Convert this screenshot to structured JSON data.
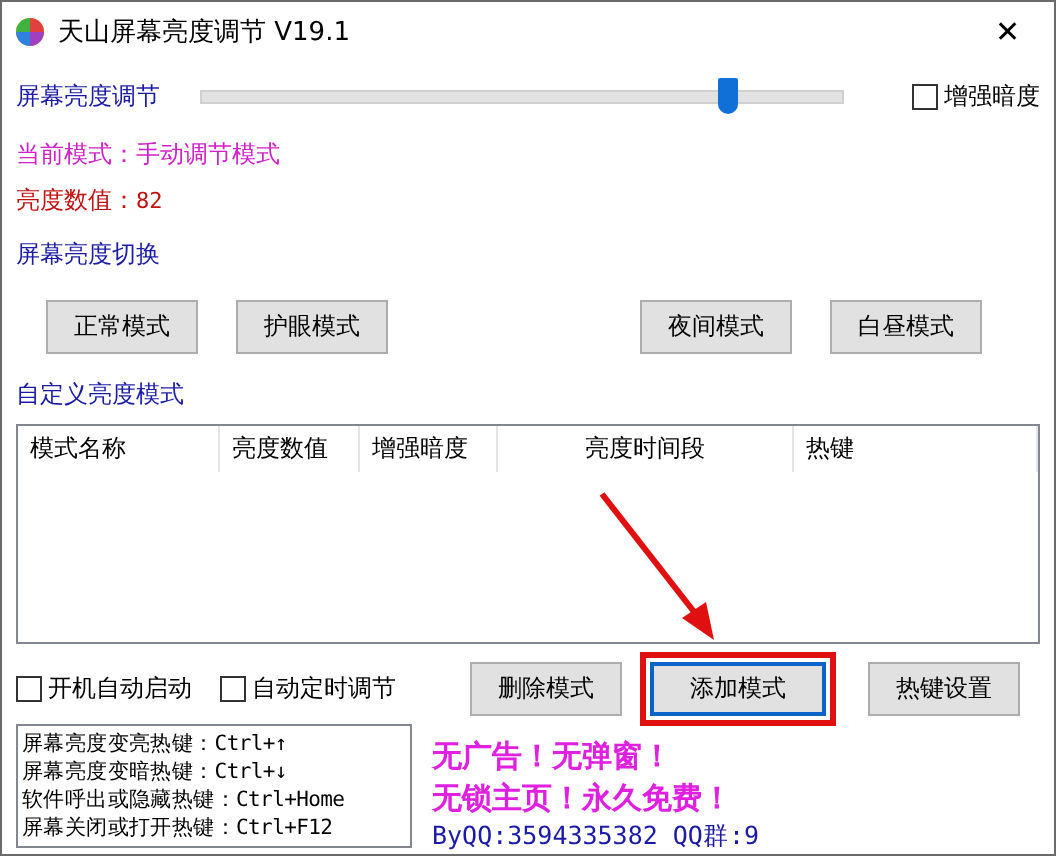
{
  "window": {
    "title": "天山屏幕亮度调节 V19.1",
    "close": "✕"
  },
  "brightness": {
    "label": "屏幕亮度调节",
    "level": 0.82,
    "enhance": {
      "label": "增强暗度",
      "checked": false
    }
  },
  "current_mode": "当前模式：手动调节模式",
  "brightness_value": {
    "label": "亮度数值：",
    "value": "82"
  },
  "switch_section": {
    "title": "屏幕亮度切换",
    "buttons": [
      "正常模式",
      "护眼模式",
      "夜间模式",
      "白昼模式"
    ]
  },
  "custom_section": {
    "title": "自定义亮度模式",
    "columns": [
      "模式名称",
      "亮度数值",
      "增强暗度",
      "亮度时间段",
      "热键"
    ]
  },
  "options": [
    {
      "label": "开机自动启动",
      "checked": false
    },
    {
      "label": "自动定时调节",
      "checked": false
    }
  ],
  "actions": [
    {
      "label": "删除模式",
      "focused": false
    },
    {
      "label": "添加模式",
      "focused": true
    },
    {
      "label": "热键设置",
      "focused": false
    }
  ],
  "hotkeys": [
    "屏幕亮度变亮热键：Ctrl+↑",
    "屏幕亮度变暗热键：Ctrl+↓",
    "软件呼出或隐藏热键：Ctrl+Home",
    "屏幕关闭或打开热键：Ctrl+F12"
  ],
  "promo": [
    "无广告！无弹窗！",
    "无锁主页！永久免费！"
  ],
  "contact": "ByQQ:3594335382 QQ群:9"
}
